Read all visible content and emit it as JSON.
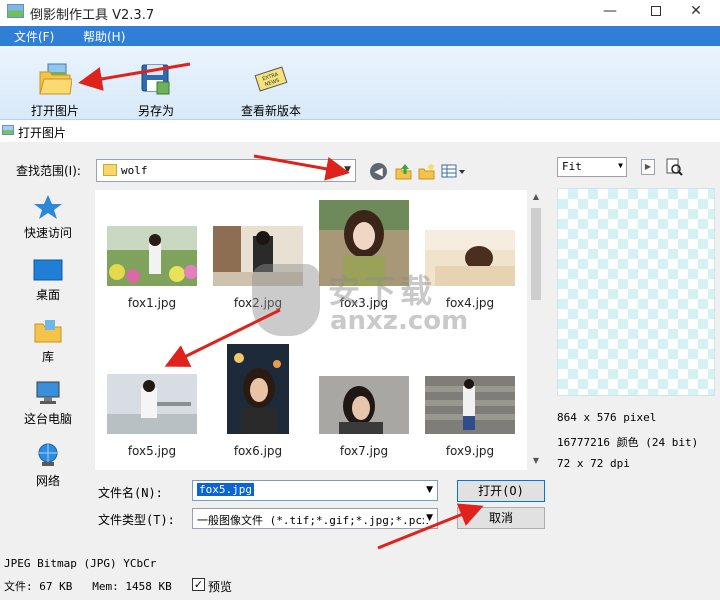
{
  "window": {
    "title": "倒影制作工具 V2.3.7"
  },
  "menu": {
    "file": "文件(F)",
    "help": "帮助(H)"
  },
  "toolbar": {
    "open_label": "打开图片",
    "saveas_label": "另存为",
    "version_label": "查看新版本"
  },
  "dialog": {
    "caption": "打开图片",
    "look_in_label": "查找范围(I):",
    "look_in_value": "wolf",
    "places": [
      "快速访问",
      "桌面",
      "库",
      "这台电脑",
      "网络"
    ],
    "files": [
      "fox1.jpg",
      "fox2.jpg",
      "fox3.jpg",
      "fox4.jpg",
      "fox5.jpg",
      "fox6.jpg",
      "fox7.jpg",
      "fox9.jpg"
    ],
    "filename_label": "文件名(N):",
    "filename_value": "fox5.jpg",
    "filetype_label": "文件类型(T):",
    "filetype_value": "一般图像文件 (*.tif;*.gif;*.jpg;*.pcx",
    "open_button": "打开(O)",
    "cancel_button": "取消"
  },
  "preview": {
    "zoom_value": "Fit",
    "dimensions": "864 x 576 pixel",
    "colors": "16777216 颜色 (24 bit)",
    "dpi": "72 x 72 dpi"
  },
  "status": {
    "format": "JPEG Bitmap (JPG) YCbCr",
    "size": "文件: 67 KB   Mem: 1458 KB",
    "preview_label": "预览",
    "preview_checked": true
  },
  "watermark": {
    "line1": "安下载",
    "line2": "anxz.com"
  },
  "colors": {
    "menubar": "#2f7fd6",
    "arrow": "#e0221c",
    "selection": "#0a64d6"
  }
}
